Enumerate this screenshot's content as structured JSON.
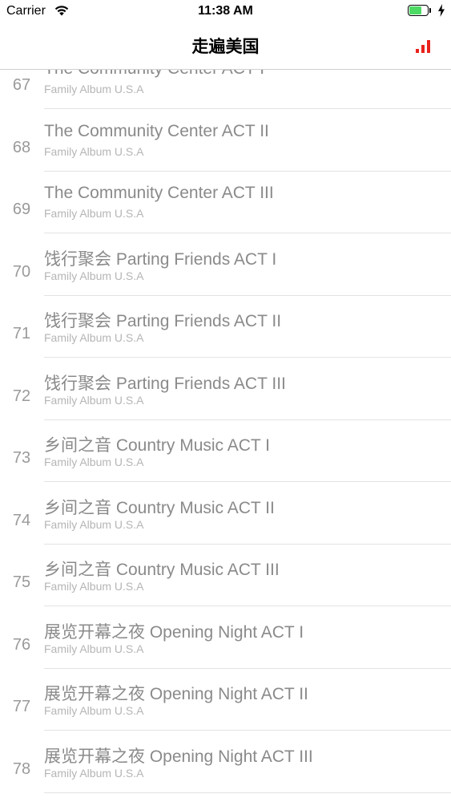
{
  "status_bar": {
    "carrier": "Carrier",
    "time": "11:38 AM",
    "battery_level": 0.7,
    "icons": [
      "wifi-icon",
      "battery-icon",
      "charging-bolt-icon"
    ]
  },
  "nav": {
    "title": "走遍美国",
    "right_icon": "signal-bars-icon",
    "accent_color": "#e8221b"
  },
  "list": {
    "items": [
      {
        "number": "67",
        "title": "The Community Center ACT I",
        "subtitle": "Family Album U.S.A"
      },
      {
        "number": "68",
        "title": "The Community Center ACT II",
        "subtitle": "Family Album U.S.A"
      },
      {
        "number": "69",
        "title": "The Community Center ACT III",
        "subtitle": "Family Album U.S.A"
      },
      {
        "number": "70",
        "title": "饯行聚会 Parting Friends ACT I",
        "subtitle": "Family Album U.S.A"
      },
      {
        "number": "71",
        "title": "饯行聚会 Parting Friends ACT II",
        "subtitle": "Family Album U.S.A"
      },
      {
        "number": "72",
        "title": "饯行聚会 Parting Friends ACT III",
        "subtitle": "Family Album U.S.A"
      },
      {
        "number": "73",
        "title": "乡间之音 Country Music ACT I",
        "subtitle": "Family Album U.S.A"
      },
      {
        "number": "74",
        "title": "乡间之音 Country Music ACT II",
        "subtitle": "Family Album U.S.A"
      },
      {
        "number": "75",
        "title": "乡间之音 Country Music ACT III",
        "subtitle": "Family Album U.S.A"
      },
      {
        "number": "76",
        "title": "展览开幕之夜 Opening Night ACT I",
        "subtitle": "Family Album U.S.A"
      },
      {
        "number": "77",
        "title": "展览开幕之夜 Opening Night ACT II",
        "subtitle": "Family Album U.S.A"
      },
      {
        "number": "78",
        "title": "展览开幕之夜 Opening Night ACT III",
        "subtitle": "Family Album U.S.A"
      }
    ]
  }
}
